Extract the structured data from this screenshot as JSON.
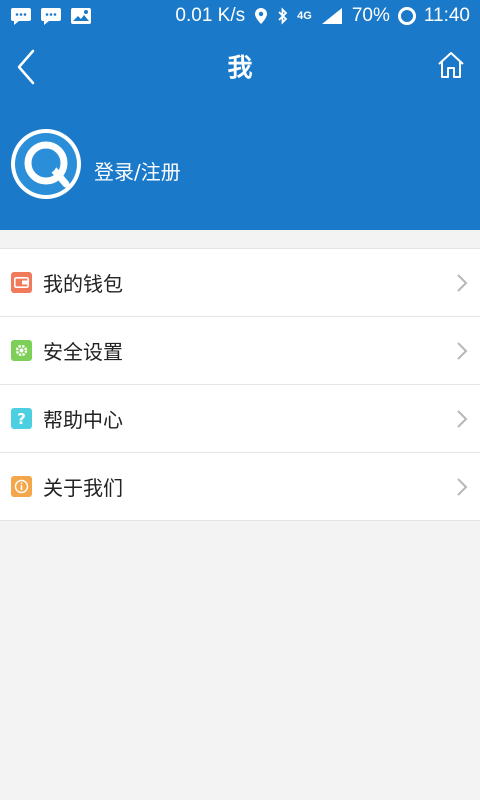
{
  "status_bar": {
    "net_speed": "0.01 K/s",
    "network_type": "4G",
    "battery": "70%",
    "time": "11:40",
    "icons": [
      "chat-bubble-icon",
      "chat-bubble-icon",
      "image-notification-icon",
      "location-icon",
      "bluetooth-icon",
      "signal-icon",
      "battery-icon"
    ]
  },
  "header": {
    "title": "我",
    "back_icon": "chevron-left-icon",
    "home_icon": "home-icon"
  },
  "profile": {
    "login_label": "登录/注册",
    "avatar_icon": "q-logo-icon"
  },
  "menu": {
    "items": [
      {
        "label": "我的钱包",
        "icon": "wallet-icon",
        "color": "#f07a5a"
      },
      {
        "label": "安全设置",
        "icon": "gear-icon",
        "color": "#7ccf57"
      },
      {
        "label": "帮助中心",
        "icon": "help-icon",
        "color": "#4ccfe0"
      },
      {
        "label": "关于我们",
        "icon": "info-icon",
        "color": "#f4a64a"
      }
    ]
  },
  "colors": {
    "primary": "#1a79c8",
    "background": "#f3f3f3",
    "chevron": "#b7b7b7"
  }
}
